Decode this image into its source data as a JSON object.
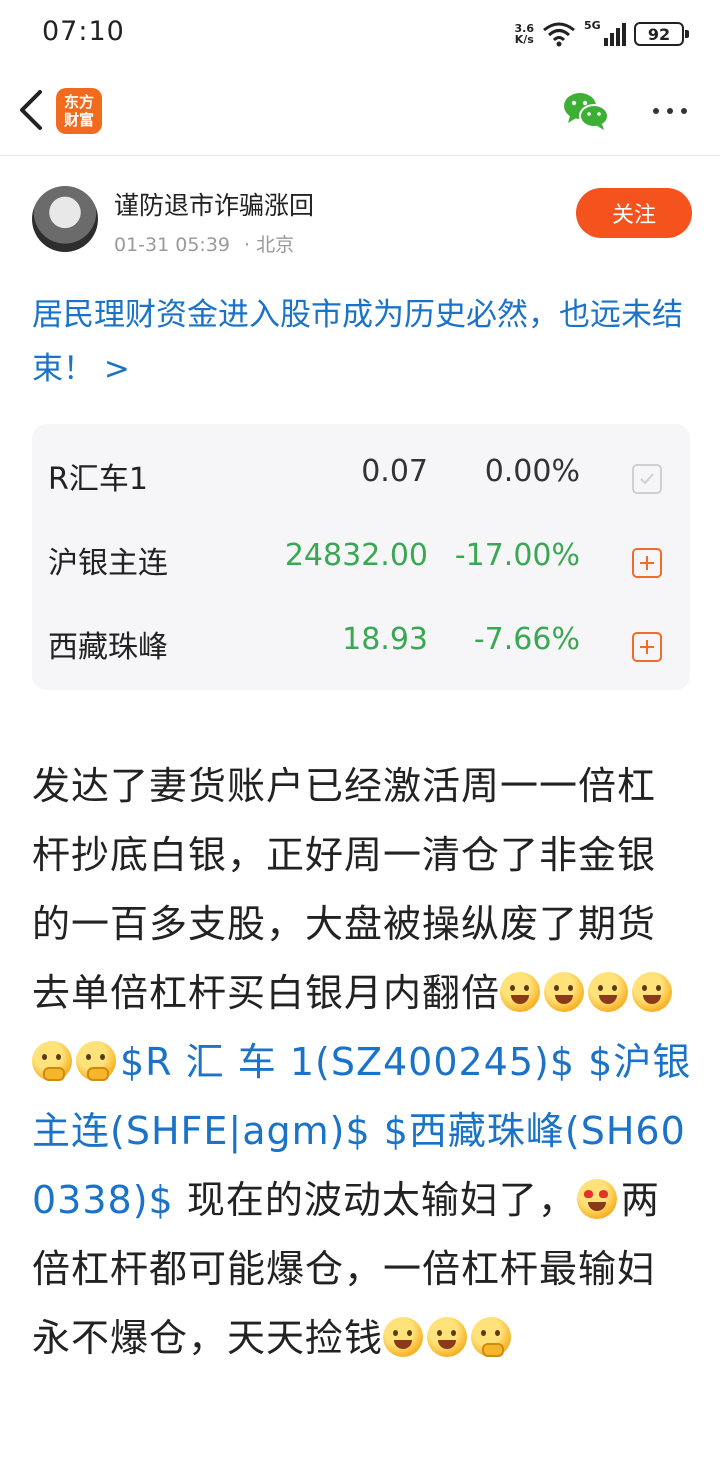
{
  "status_bar": {
    "time": "07:10",
    "net_speed_value": "3.6",
    "net_speed_unit": "K/s",
    "signal_label": "5G",
    "battery": "92"
  },
  "nav": {
    "logo_line1": "东方",
    "logo_line2": "财富",
    "brand_color": "#f26a1d"
  },
  "author": {
    "name": "谨防退市诈骗涨回",
    "time": "01-31 05:39",
    "location": "· 北京",
    "follow_label": "关注"
  },
  "post": {
    "title": "居民理财资金进入股市成为历史必然，也远未结束！ >"
  },
  "stocks": [
    {
      "name": "R汇车1",
      "price": "0.07",
      "change": "0.00%",
      "state": "added"
    },
    {
      "name": "沪银主连",
      "price": "24832.00",
      "change": "-17.00%",
      "state": "add"
    },
    {
      "name": "西藏珠峰",
      "price": "18.93",
      "change": "-7.66%",
      "state": "add"
    }
  ],
  "body": {
    "p1": "发达了妻货账户已经激活周一一倍杠杆抄底白银，正好周一清仓了非金银的一百多支股，大盘被操纵废了期货去单倍杠杆买白银月内翻倍",
    "link1": "$R 汇 车 1(SZ400245)$",
    "link2": "$沪银主连(SHFE|agm)$",
    "link3": "$西藏珠峰(SH600338)$",
    "p2": "现在的波动太输妇了，",
    "p3": "两倍杠杆都可能爆仓，一倍杠杆最输妇永不爆仓，天天捡钱"
  },
  "colors": {
    "link": "#1a73c8",
    "down": "#3aa853",
    "follow": "#f4531e"
  }
}
